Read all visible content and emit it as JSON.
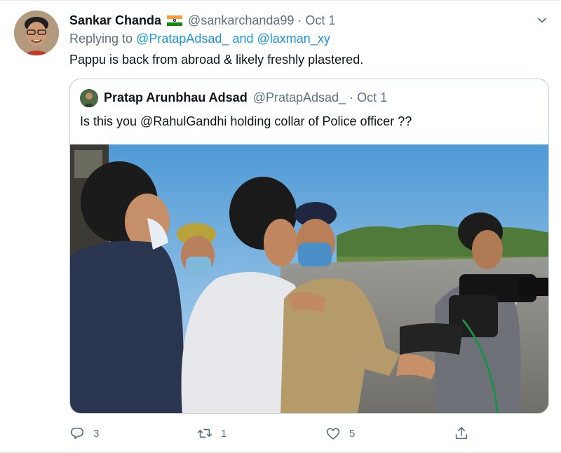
{
  "tweet": {
    "author_name": "Sankar Chanda",
    "author_handle": "@sankarchanda99",
    "date": "Oct 1",
    "replying_prefix": "Replying to",
    "replying_to_1": "@PratapAdsad_",
    "replying_and": "and",
    "replying_to_2": "@laxman_xy",
    "text": "Pappu is back from abroad & likely freshly plastered."
  },
  "quoted": {
    "author_name": "Pratap Arunbhau Adsad",
    "author_handle": "@PratapAdsad_",
    "date": "Oct 1",
    "text": "Is this you @RahulGandhi holding collar of Police officer ??"
  },
  "actions": {
    "reply_count": "3",
    "retweet_count": "1",
    "like_count": "5"
  },
  "colors": {
    "link": "#1b95e0",
    "muted": "#5b7083",
    "border": "#c4cfd6"
  },
  "icons": {
    "reply": "reply-icon",
    "retweet": "retweet-icon",
    "like": "like-icon",
    "share": "share-icon",
    "more": "chevron-down-icon",
    "flag": "india-flag-icon"
  }
}
